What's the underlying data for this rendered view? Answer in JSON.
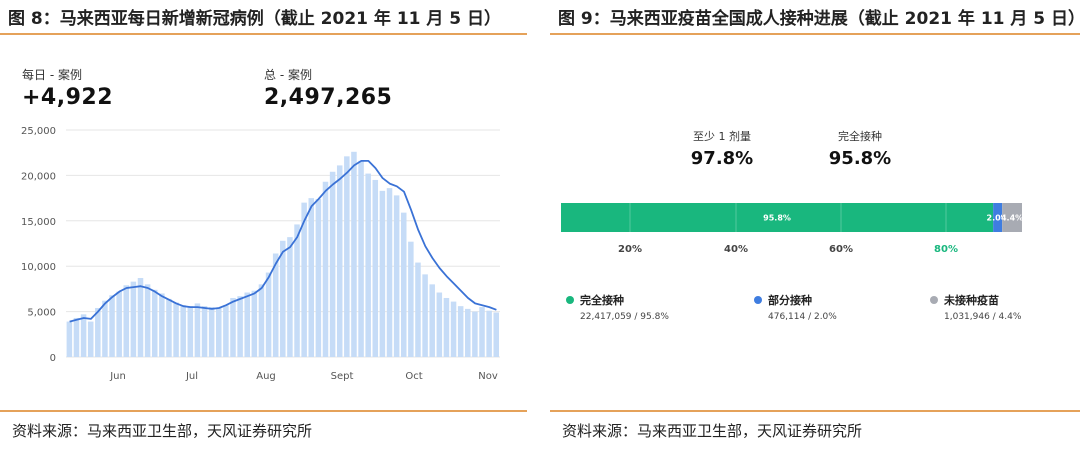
{
  "left": {
    "title": "图 8：马来西亚每日新增新冠病例（截止 2021 年 11 月 5 日）",
    "daily_label": "每日 - 案例",
    "daily_value": "+4,922",
    "total_label": "总 - 案例",
    "total_value": "2,497,265",
    "source": "资料来源：马来西亚卫生部，天风证券研究所"
  },
  "right": {
    "title": "图 9：马来西亚疫苗全国成人接种进展（截止 2021 年 11 月 5 日）",
    "stat1_label": "至少 1 剂量",
    "stat1_value": "97.8%",
    "stat2_label": "完全接种",
    "stat2_value": "95.8%",
    "source": "资料来源：马来西亚卫生部，天风证券研究所",
    "legend": [
      {
        "label": "完全接种",
        "detail": "22,417,059 / 95.8%",
        "color": "#19b77e"
      },
      {
        "label": "部分接种",
        "detail": "476,114 / 2.0%",
        "color": "#3f7de0"
      },
      {
        "label": "未接种疫苗",
        "detail": "1,031,946 / 4.4%",
        "color": "#a8abb3"
      }
    ]
  },
  "colors": {
    "accent_rule": "#e5a25a",
    "bar": "#c6dcf7",
    "line": "#3a72d6"
  },
  "chart_data": [
    {
      "type": "bar",
      "title": "",
      "x_tick_labels": [
        "Jun",
        "Jul",
        "Aug",
        "Sept",
        "Oct",
        "Nov"
      ],
      "y_tick_labels": [
        "0",
        "5,000",
        "10,000",
        "15,000",
        "20,000",
        "25,000"
      ],
      "ylim": [
        0,
        25000
      ],
      "grid": true,
      "series": [
        {
          "type": "bar",
          "values_monthly_sample": [
            3900,
            4300,
            4700,
            3900,
            5400,
            6200,
            6800,
            7200,
            7900,
            8300,
            8700,
            8000,
            7400,
            7000,
            6400,
            6000,
            5700,
            5600,
            5900,
            5600,
            5500,
            5400,
            5700,
            6500,
            6700,
            7100,
            7300,
            8000,
            9300,
            11400,
            12800,
            13200,
            14600,
            17000,
            17500,
            17400,
            19300,
            20400,
            21100,
            22100,
            22600,
            21600,
            20200,
            19500,
            18300,
            18600,
            17800,
            15900,
            12700,
            10400,
            9100,
            8000,
            7100,
            6500,
            6100,
            5600,
            5300,
            5000,
            5500,
            5100,
            4900
          ]
        },
        {
          "type": "line",
          "values_monthly_sample": [
            3900,
            4100,
            4300,
            4200,
            5000,
            5900,
            6600,
            7200,
            7600,
            7700,
            7800,
            7600,
            7200,
            6700,
            6300,
            5900,
            5600,
            5500,
            5500,
            5400,
            5300,
            5400,
            5700,
            6100,
            6400,
            6700,
            7000,
            7600,
            8800,
            10300,
            11600,
            12100,
            13200,
            15000,
            16600,
            17400,
            18300,
            19000,
            19600,
            20300,
            21100,
            21600,
            21600,
            20800,
            19700,
            19100,
            18800,
            18200,
            16200,
            14000,
            12200,
            10900,
            9800,
            8900,
            8100,
            7300,
            6500,
            5900,
            5700,
            5500,
            5200
          ]
        }
      ]
    },
    {
      "type": "bar",
      "orientation": "horizontal-stacked",
      "x_tick_labels": [
        "20%",
        "40%",
        "60%",
        "80%"
      ],
      "xlim": [
        0,
        100
      ],
      "segments": [
        {
          "name": "完全接种",
          "value": 95.8,
          "label": "95.8%"
        },
        {
          "name": "部分接种",
          "value": 2.0,
          "label": "2.0%"
        },
        {
          "name": "未接种疫苗",
          "value": 4.4,
          "label": "4.4%"
        }
      ]
    }
  ]
}
